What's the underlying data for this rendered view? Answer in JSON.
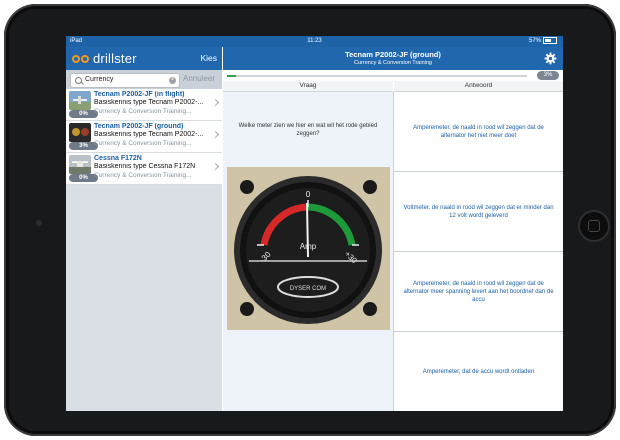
{
  "status": {
    "left": "iPad",
    "time": "11:23",
    "battery": "57%"
  },
  "sidebar": {
    "app_name": "drillster",
    "choose_label": "Kies",
    "search": {
      "value": "Currency",
      "cancel_label": "Annuleer"
    },
    "items": [
      {
        "title": "Tecnam P2002-JF (in flight)",
        "subtitle": "Basiskennis type Tecnam P2002-...",
        "meta": "Currency & Conversion Training...",
        "progress": "0%"
      },
      {
        "title": "Tecnam P2002-JF (ground)",
        "subtitle": "Basiskennis type Tecnam P2002-...",
        "meta": "Currency & Conversion Training...",
        "progress": "3%"
      },
      {
        "title": "Cessna F172N",
        "subtitle": "Basiskennis type Cessna F172N",
        "meta": "Currency & Conversion Training...",
        "progress": "0%"
      }
    ]
  },
  "header": {
    "title": "Tecnam P2002-JF (ground)",
    "subtitle": "Currency & Conversion Training"
  },
  "progress": {
    "value": 0.03,
    "label": "3%"
  },
  "columns": {
    "question": "Vraag",
    "answer": "Antwoord"
  },
  "question": {
    "text": "Welke meter zien we hier en wat wil het rode gebied zeggen?",
    "gauge": {
      "scale_left": "-30",
      "scale_zero": "0",
      "scale_right": "+30",
      "unit": "Amp",
      "brand": "DYSER COM"
    }
  },
  "answers": [
    "Amperemeter, de naald in rood wil zeggen dat de alternator het niet meer doet",
    "Voltmeter, de naald in rood wil zeggen dat er minder dan 12 volt wordt geleverd",
    "Amperemeter, de naald in rood wil zeggen dat de alternator meer spanning levert aan het boordnet dan de accu",
    "Amperemeter, dat de accu wordt ontladen"
  ],
  "colors": {
    "nav_blue": "#2067ad",
    "link_blue": "#1b5fa6",
    "progress_green": "#2fa84f",
    "logo_orange": "#f39a1e"
  },
  "icons": [
    "search-icon",
    "clear-icon",
    "chevron-right-icon",
    "gear-icon",
    "battery-icon"
  ]
}
